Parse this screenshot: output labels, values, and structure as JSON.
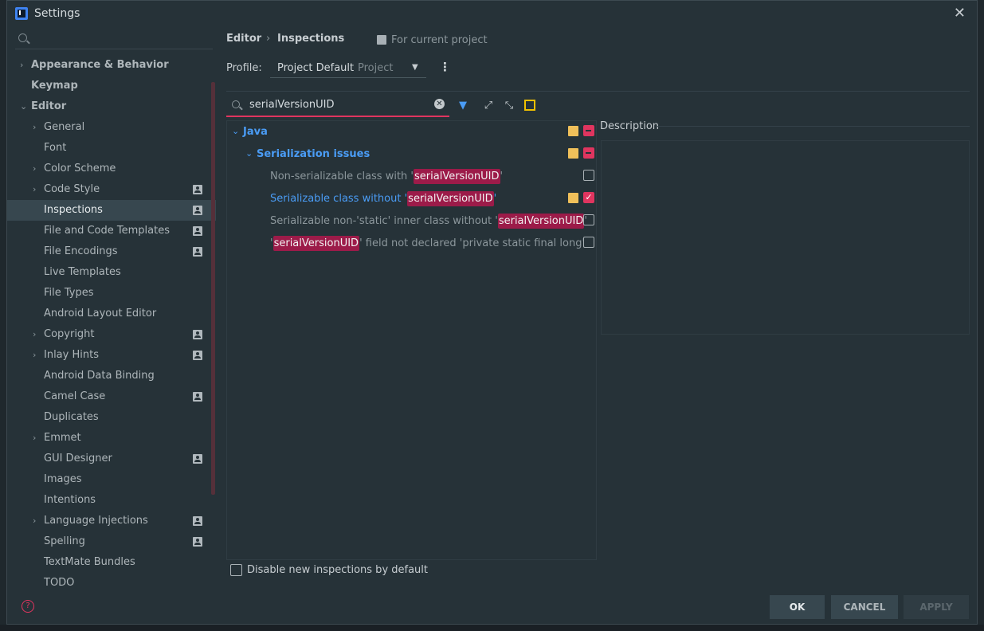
{
  "window": {
    "title": "Settings",
    "close_label": "✕"
  },
  "sidebar": {
    "search_value": "",
    "items": [
      {
        "label": "Appearance & Behavior",
        "chevron": "›",
        "bold": true,
        "project": false
      },
      {
        "label": "Keymap",
        "chevron": "",
        "bold": true,
        "project": false
      },
      {
        "label": "Editor",
        "chevron": "⌄",
        "bold": true,
        "project": false
      },
      {
        "label": "General",
        "chevron": "›",
        "bold": false,
        "project": false
      },
      {
        "label": "Font",
        "chevron": "",
        "bold": false,
        "project": false
      },
      {
        "label": "Color Scheme",
        "chevron": "›",
        "bold": false,
        "project": false
      },
      {
        "label": "Code Style",
        "chevron": "›",
        "bold": false,
        "project": true
      },
      {
        "label": "Inspections",
        "chevron": "",
        "bold": false,
        "project": true,
        "selected": true
      },
      {
        "label": "File and Code Templates",
        "chevron": "",
        "bold": false,
        "project": true
      },
      {
        "label": "File Encodings",
        "chevron": "",
        "bold": false,
        "project": true
      },
      {
        "label": "Live Templates",
        "chevron": "",
        "bold": false,
        "project": false
      },
      {
        "label": "File Types",
        "chevron": "",
        "bold": false,
        "project": false
      },
      {
        "label": "Android Layout Editor",
        "chevron": "",
        "bold": false,
        "project": false
      },
      {
        "label": "Copyright",
        "chevron": "›",
        "bold": false,
        "project": true
      },
      {
        "label": "Inlay Hints",
        "chevron": "›",
        "bold": false,
        "project": true
      },
      {
        "label": "Android Data Binding",
        "chevron": "",
        "bold": false,
        "project": false
      },
      {
        "label": "Camel Case",
        "chevron": "",
        "bold": false,
        "project": true
      },
      {
        "label": "Duplicates",
        "chevron": "",
        "bold": false,
        "project": false
      },
      {
        "label": "Emmet",
        "chevron": "›",
        "bold": false,
        "project": false
      },
      {
        "label": "GUI Designer",
        "chevron": "",
        "bold": false,
        "project": true
      },
      {
        "label": "Images",
        "chevron": "",
        "bold": false,
        "project": false
      },
      {
        "label": "Intentions",
        "chevron": "",
        "bold": false,
        "project": false
      },
      {
        "label": "Language Injections",
        "chevron": "›",
        "bold": false,
        "project": true
      },
      {
        "label": "Spelling",
        "chevron": "",
        "bold": false,
        "project": true
      },
      {
        "label": "TextMate Bundles",
        "chevron": "",
        "bold": false,
        "project": false
      },
      {
        "label": "TODO",
        "chevron": "",
        "bold": false,
        "project": false
      }
    ],
    "help_label": "?"
  },
  "breadcrumb": {
    "part1": "Editor",
    "sep": "›",
    "part2": "Inspections",
    "scope": "For current project"
  },
  "profile": {
    "label": "Profile:",
    "value": "Project Default",
    "type": "Project",
    "arrow": "▼",
    "more": "⋮"
  },
  "filter": {
    "value": "serialVersionUID",
    "clear": "✕"
  },
  "toolbar": {
    "filter_icon": "▼",
    "expand_icon": "⤢",
    "collapse_icon": "⤡"
  },
  "tree": {
    "java": "Java",
    "group": "Serialization issues",
    "items": [
      {
        "pre": "Non-serializable class with '",
        "hl": "serialVersionUID",
        "post": "'"
      },
      {
        "pre": "Serializable class without '",
        "hl": "serialVersionUID",
        "post": "'"
      },
      {
        "pre": "Serializable non-'static' inner class without '",
        "hl": "serialVersionUID",
        "post": "'"
      },
      {
        "pre": "'",
        "hl": "serialVersionUID",
        "post": "' field not declared 'private static final long'"
      }
    ]
  },
  "description": {
    "label": "Description"
  },
  "disable_new": {
    "label": "Disable new inspections by default",
    "checked": false
  },
  "buttons": {
    "ok": "OK",
    "cancel": "CANCEL",
    "apply": "APPLY"
  },
  "colors": {
    "accent": "#e0355f",
    "link": "#4a9cf5",
    "warning": "#f0c05a",
    "background": "#263238",
    "selection": "#37474f"
  }
}
